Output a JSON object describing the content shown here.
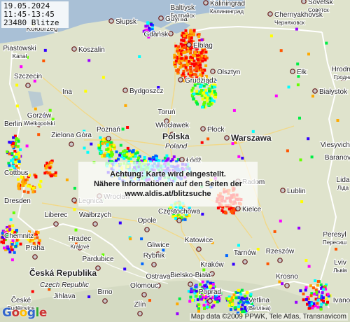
{
  "info": {
    "date": "19.05.2024",
    "time_range": "11:45-13:45",
    "count": "23480 Blitze"
  },
  "notice": {
    "line1": "Achtung: Karte wird eingestellt.",
    "line2": "Nähere Informationen auf den Seiten der",
    "line3": "www.aldis.at/blitzsuche"
  },
  "attribution": "Map data ©2009 PPWK, Tele Atlas, Transnavicom",
  "logo": "Google",
  "colors": {
    "land": "#dfe3cc",
    "sea": "#a9c0d6",
    "border": "#ffffff",
    "strike_old": "#ff0000",
    "strike_new": "#ff00ff"
  },
  "cities": [
    {
      "name": "Gdynia",
      "id": "gdynia"
    },
    {
      "name": "Gdańsk",
      "id": "gdansk"
    },
    {
      "name": "Elbląg",
      "id": "elblag"
    },
    {
      "name": "Kaliningrad\nКалининград",
      "id": "kaliningrad"
    },
    {
      "name": "Baltiysk\nБалтийск",
      "id": "baltiysk"
    },
    {
      "name": "Sovetsk\nСоветск",
      "id": "sovetsk"
    },
    {
      "name": "Chernyakhovsk\nЧерняховск",
      "id": "chernyakhovsk"
    },
    {
      "name": "Słupsk",
      "id": "slupsk"
    },
    {
      "name": "Koszalin",
      "id": "koszalin"
    },
    {
      "name": "Piastowski\nKanał",
      "id": "piastowski"
    },
    {
      "name": "Szczecin",
      "id": "szczecin"
    },
    {
      "name": "Ina",
      "id": "ina"
    },
    {
      "name": "Bydgoszcz",
      "id": "bydgoszcz"
    },
    {
      "name": "Toruń",
      "id": "torun"
    },
    {
      "name": "Grudziądz",
      "id": "grudziadz"
    },
    {
      "name": "Olsztyn",
      "id": "olsztyn"
    },
    {
      "name": "Ełk",
      "id": "elk"
    },
    {
      "name": "Hrodna\nГродна",
      "id": "hrodna"
    },
    {
      "name": "Białystok",
      "id": "bialystok"
    },
    {
      "name": "Gorzów\nWielkopolski",
      "id": "gorzow"
    },
    {
      "name": "Poznań",
      "id": "poznan"
    },
    {
      "name": "Włocławek",
      "id": "wloclawek"
    },
    {
      "name": "Płock",
      "id": "plock"
    },
    {
      "name": "Warszawa",
      "id": "warszawa"
    },
    {
      "name": "Polska",
      "id": "polska"
    },
    {
      "name": "Poland",
      "id": "poland"
    },
    {
      "name": "Łódź",
      "id": "lodz"
    },
    {
      "name": "Zielona Góra",
      "id": "zielona"
    },
    {
      "name": "Legnica",
      "id": "legnica"
    },
    {
      "name": "Wrocław",
      "id": "wroclaw"
    },
    {
      "name": "Radom",
      "id": "radom"
    },
    {
      "name": "Lublin",
      "id": "lublin"
    },
    {
      "name": "Kielce",
      "id": "kielce"
    },
    {
      "name": "Częstochowa",
      "id": "czestochowa"
    },
    {
      "name": "Opole",
      "id": "opole"
    },
    {
      "name": "Wałbrzych",
      "id": "walbrzych"
    },
    {
      "name": "Liberec",
      "id": "liberec"
    },
    {
      "name": "Praha",
      "id": "praha"
    },
    {
      "name": "Hradec\nKrálové",
      "id": "hradec"
    },
    {
      "name": "Pardubice",
      "id": "pardubice"
    },
    {
      "name": "Gliwice",
      "id": "gliwice"
    },
    {
      "name": "Katowice",
      "id": "katowice"
    },
    {
      "name": "Rybnik",
      "id": "rybnik"
    },
    {
      "name": "Tarnów",
      "id": "tarnow"
    },
    {
      "name": "Rzeszów",
      "id": "rzeszow"
    },
    {
      "name": "Peresyl\nПересиш",
      "id": "peresyl"
    },
    {
      "name": "Lviv\nЛьвів",
      "id": "lviv"
    },
    {
      "name": "Kraków",
      "id": "krakow"
    },
    {
      "name": "Ostrava",
      "id": "ostrava"
    },
    {
      "name": "Olomouc",
      "id": "olomouc"
    },
    {
      "name": "Česká Republika",
      "id": "ceska"
    },
    {
      "name": "Czech Republic",
      "id": "czech"
    },
    {
      "name": "Brno",
      "id": "brno"
    },
    {
      "name": "Zlín",
      "id": "zlin"
    },
    {
      "name": "Bielsko-Biała",
      "id": "bielsko"
    },
    {
      "name": "Poprad",
      "id": "poprad"
    },
    {
      "name": "Vetlina\n(Ветліна)",
      "id": "vetlina"
    },
    {
      "name": "Krosno",
      "id": "krosno"
    },
    {
      "name": "Jihlava",
      "id": "jihlava"
    },
    {
      "name": "České\nBudějovice",
      "id": "budejovice"
    },
    {
      "name": "Berlin",
      "id": "berlin"
    },
    {
      "name": "Cottbus",
      "id": "cottbus"
    },
    {
      "name": "Dresden",
      "id": "dresden"
    },
    {
      "name": "Chemnitz",
      "id": "chemnitz"
    },
    {
      "name": "Ivano",
      "id": "ivano"
    },
    {
      "name": "Lida\nЛіда",
      "id": "lida"
    },
    {
      "name": "Baranovichi",
      "id": "baranovichi"
    },
    {
      "name": "Viesyvichi",
      "id": "viesyvichi"
    },
    {
      "name": "Kołobrzeg",
      "id": "kolobrzeg"
    }
  ]
}
